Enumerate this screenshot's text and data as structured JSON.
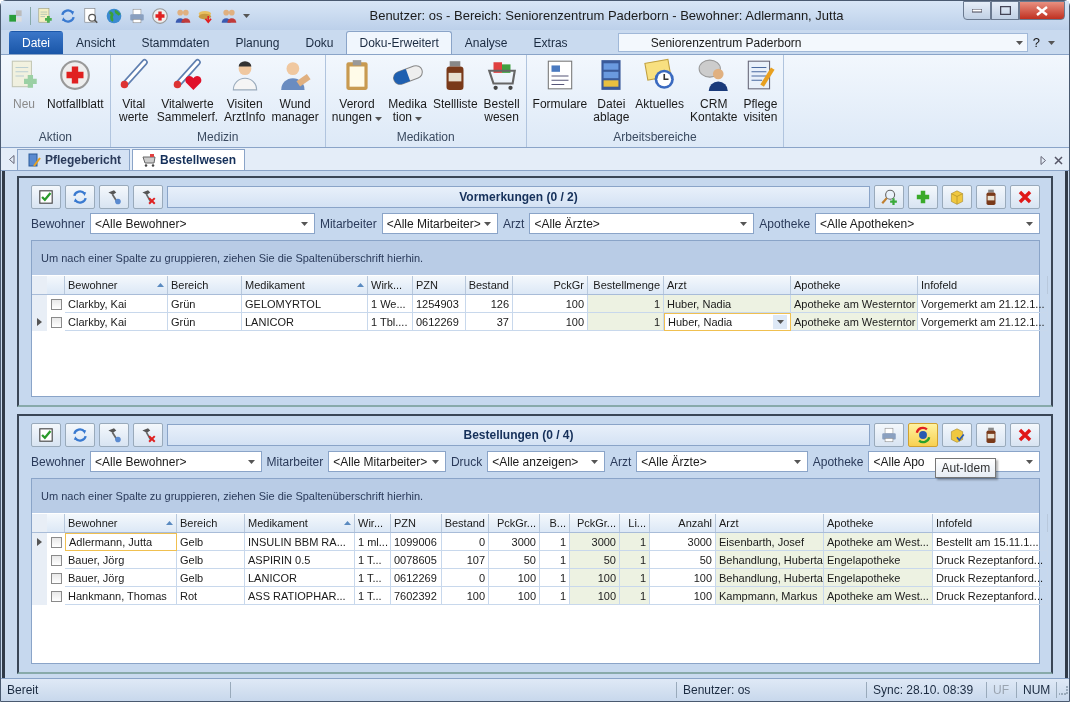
{
  "window": {
    "title": "Benutzer: os - Bereich: Seniorenzentrum Paderborn - Bewohner: Adlermann, Jutta"
  },
  "ribbon_tabs": [
    {
      "label": "Datei",
      "kind": "file",
      "selected": false
    },
    {
      "label": "Ansicht",
      "kind": "tab",
      "selected": false
    },
    {
      "label": "Stammdaten",
      "kind": "tab",
      "selected": false
    },
    {
      "label": "Planung",
      "kind": "tab",
      "selected": false
    },
    {
      "label": "Doku",
      "kind": "tab",
      "selected": false
    },
    {
      "label": "Doku-Erweitert",
      "kind": "tab",
      "selected": true
    },
    {
      "label": "Analyse",
      "kind": "tab",
      "selected": false
    },
    {
      "label": "Extras",
      "kind": "tab",
      "selected": false
    }
  ],
  "location_combo": {
    "value": "Seniorenzentrum Paderborn"
  },
  "help": "?",
  "ribbon_groups": [
    {
      "label": "Aktion",
      "buttons": [
        {
          "lines": [
            "Neu"
          ],
          "disabled": true,
          "dropdown": false
        },
        {
          "lines": [
            "Notfallblatt"
          ],
          "disabled": false,
          "dropdown": false
        }
      ]
    },
    {
      "label": "Medizin",
      "buttons": [
        {
          "lines": [
            "Vital",
            "werte"
          ],
          "disabled": false,
          "dropdown": false
        },
        {
          "lines": [
            "Vitalwerte",
            "Sammelerf."
          ],
          "disabled": false,
          "dropdown": false
        },
        {
          "lines": [
            "Visiten",
            "ArztInfo"
          ],
          "disabled": false,
          "dropdown": false
        },
        {
          "lines": [
            "Wund",
            "manager"
          ],
          "disabled": false,
          "dropdown": false
        }
      ]
    },
    {
      "label": "Medikation",
      "buttons": [
        {
          "lines": [
            "Verord",
            "nungen"
          ],
          "disabled": false,
          "dropdown": true
        },
        {
          "lines": [
            "Medika",
            "tion"
          ],
          "disabled": false,
          "dropdown": true
        },
        {
          "lines": [
            "Stellliste"
          ],
          "disabled": false,
          "dropdown": false
        },
        {
          "lines": [
            "Bestell",
            "wesen"
          ],
          "disabled": false,
          "dropdown": false
        }
      ]
    },
    {
      "label": "Arbeitsbereiche",
      "buttons": [
        {
          "lines": [
            "Formulare"
          ],
          "disabled": false,
          "dropdown": false
        },
        {
          "lines": [
            "Datei",
            "ablage"
          ],
          "disabled": false,
          "dropdown": false
        },
        {
          "lines": [
            "Aktuelles"
          ],
          "disabled": false,
          "dropdown": false
        },
        {
          "lines": [
            "CRM",
            "Kontakte"
          ],
          "disabled": false,
          "dropdown": false
        },
        {
          "lines": [
            "Pflege",
            "visiten"
          ],
          "disabled": false,
          "dropdown": false
        }
      ]
    }
  ],
  "doc_tabs": [
    {
      "label": "Pflegebericht",
      "selected": false
    },
    {
      "label": "Bestellwesen",
      "selected": true
    }
  ],
  "panels": [
    {
      "title": "Vormerkungen (0 / 2)",
      "right_tools": [
        {
          "highlighted": false
        },
        {
          "highlighted": false
        },
        {
          "highlighted": false
        },
        {
          "highlighted": false
        },
        {
          "highlighted": false
        }
      ],
      "filters": [
        {
          "label": "Bewohner",
          "value": "<Alle Bewohner>"
        },
        {
          "label": "Mitarbeiter",
          "value": "<Alle Mitarbeiter>"
        },
        {
          "label": "Arzt",
          "value": "<Alle Ärzte>"
        },
        {
          "label": "Apotheke",
          "value": "<Alle Apotheken>"
        }
      ],
      "group_hint": "Um nach einer Spalte zu gruppieren, ziehen Sie die Spaltenüberschrift hierhin.",
      "editor_open": true,
      "columns": [
        {
          "label": "Bewohner",
          "sorted": true,
          "numeric": false,
          "editable": false,
          "focus": false
        },
        {
          "label": "Bereich",
          "numeric": false,
          "editable": false,
          "focus": false
        },
        {
          "label": "Medikament",
          "sorted": true,
          "numeric": false,
          "editable": false,
          "focus": false
        },
        {
          "label": "Wirk...",
          "numeric": false,
          "editable": false,
          "focus": false
        },
        {
          "label": "PZN",
          "numeric": false,
          "editable": false,
          "focus": false
        },
        {
          "label": "Bestand",
          "numeric": true,
          "editable": false,
          "focus": false
        },
        {
          "label": "PckGr",
          "numeric": true,
          "editable": false,
          "focus": false
        },
        {
          "label": "Bestellmenge",
          "numeric": true,
          "editable": true,
          "focus": false
        },
        {
          "label": "Arzt",
          "numeric": false,
          "editable": true,
          "focus": true
        },
        {
          "label": "Apotheke",
          "numeric": false,
          "editable": true,
          "focus": false
        },
        {
          "label": "Infofeld",
          "numeric": false,
          "editable": false,
          "focus": false
        }
      ],
      "rows": [
        {
          "current": false,
          "checked": false,
          "cells": [
            "Clarkby, Kai",
            "Grün",
            "GELOMYRTOL",
            "1 We...",
            "1254903",
            "126",
            "100",
            "1",
            "Huber, Nadia",
            "Apotheke am Westerntor",
            "Vorgemerkt  am 21.12.1..."
          ]
        },
        {
          "current": true,
          "checked": false,
          "cells": [
            "Clarkby, Kai",
            "Grün",
            "LANICOR",
            "1 Tbl....",
            "0612269",
            "37",
            "100",
            "1",
            "Huber, Nadia",
            "Apotheke am Westerntor",
            "Vorgemerkt  am 21.12.1..."
          ]
        }
      ]
    },
    {
      "title": "Bestellungen (0 / 4)",
      "right_tools": [
        {
          "highlighted": false
        },
        {
          "highlighted": true
        },
        {
          "highlighted": false
        },
        {
          "highlighted": false
        },
        {
          "highlighted": false
        }
      ],
      "filters": [
        {
          "label": "Bewohner",
          "value": "<Alle Bewohner>"
        },
        {
          "label": "Mitarbeiter",
          "value": "<Alle Mitarbeiter>"
        },
        {
          "label": "Druck",
          "value": "<Alle anzeigen>"
        },
        {
          "label": "Arzt",
          "value": "<Alle Ärzte>"
        },
        {
          "label": "Apotheke",
          "value": "<Alle Apo"
        }
      ],
      "tooltip": "Aut-Idem",
      "group_hint": "Um nach einer Spalte zu gruppieren, ziehen Sie die Spaltenüberschrift hierhin.",
      "editor_open": false,
      "columns": [
        {
          "label": "Bewohner",
          "sorted": true,
          "numeric": false,
          "editable": false,
          "focus": true
        },
        {
          "label": "Bereich",
          "numeric": false,
          "editable": false,
          "focus": false
        },
        {
          "label": "Medikament",
          "sorted": true,
          "numeric": false,
          "editable": false,
          "focus": false
        },
        {
          "label": "Wir...",
          "numeric": false,
          "editable": false,
          "focus": false
        },
        {
          "label": "PZN",
          "numeric": false,
          "editable": false,
          "focus": false
        },
        {
          "label": "Bestand",
          "numeric": true,
          "editable": false,
          "focus": false
        },
        {
          "label": "PckGr...",
          "numeric": true,
          "editable": false,
          "focus": false
        },
        {
          "label": "B...",
          "numeric": true,
          "editable": false,
          "focus": false
        },
        {
          "label": "PckGr...",
          "numeric": true,
          "editable": true,
          "focus": false
        },
        {
          "label": "Li...",
          "numeric": true,
          "editable": true,
          "focus": false
        },
        {
          "label": "Anzahl",
          "numeric": true,
          "editable": false,
          "focus": false
        },
        {
          "label": "Arzt",
          "numeric": false,
          "editable": true,
          "focus": false
        },
        {
          "label": "Apotheke",
          "numeric": false,
          "editable": true,
          "focus": false
        },
        {
          "label": "Infofeld",
          "numeric": false,
          "editable": false,
          "focus": false
        }
      ],
      "rows": [
        {
          "current": true,
          "checked": false,
          "cells": [
            "Adlermann, Jutta",
            "Gelb",
            "INSULIN BBM RA...",
            "1 ml...",
            "1099006",
            "0",
            "3000",
            "1",
            "3000",
            "1",
            "3000",
            "Eisenbarth, Josef",
            "Apotheke am West...",
            "Bestellt  am 15.11.1..."
          ]
        },
        {
          "current": false,
          "checked": false,
          "cells": [
            "Bauer, Jörg",
            "Gelb",
            "ASPIRIN 0.5",
            "1 T...",
            "0078605",
            "107",
            "50",
            "1",
            "50",
            "1",
            "50",
            "Behandlung, Huberta",
            "Engelapotheke",
            "Druck Rezeptanford..."
          ]
        },
        {
          "current": false,
          "checked": false,
          "cells": [
            "Bauer, Jörg",
            "Gelb",
            "LANICOR",
            "1 T...",
            "0612269",
            "0",
            "100",
            "1",
            "100",
            "1",
            "100",
            "Behandlung, Huberta",
            "Engelapotheke",
            "Druck Rezeptanford..."
          ]
        },
        {
          "current": false,
          "checked": false,
          "cells": [
            "Hankmann, Thomas",
            "Rot",
            "ASS RATIOPHAR...",
            "1 T...",
            "7602392",
            "100",
            "100",
            "1",
            "100",
            "1",
            "100",
            "Kampmann, Markus",
            "Apotheke am West...",
            "Druck Rezeptanford..."
          ]
        }
      ]
    }
  ],
  "status_bar": [
    {
      "text": "Bereit",
      "disabled": false
    },
    {
      "text": "Benutzer: os",
      "disabled": false
    },
    {
      "text": "Sync: 28.10. 08:39",
      "disabled": false
    },
    {
      "text": "UF",
      "disabled": true
    },
    {
      "text": "NUM",
      "disabled": false
    }
  ]
}
